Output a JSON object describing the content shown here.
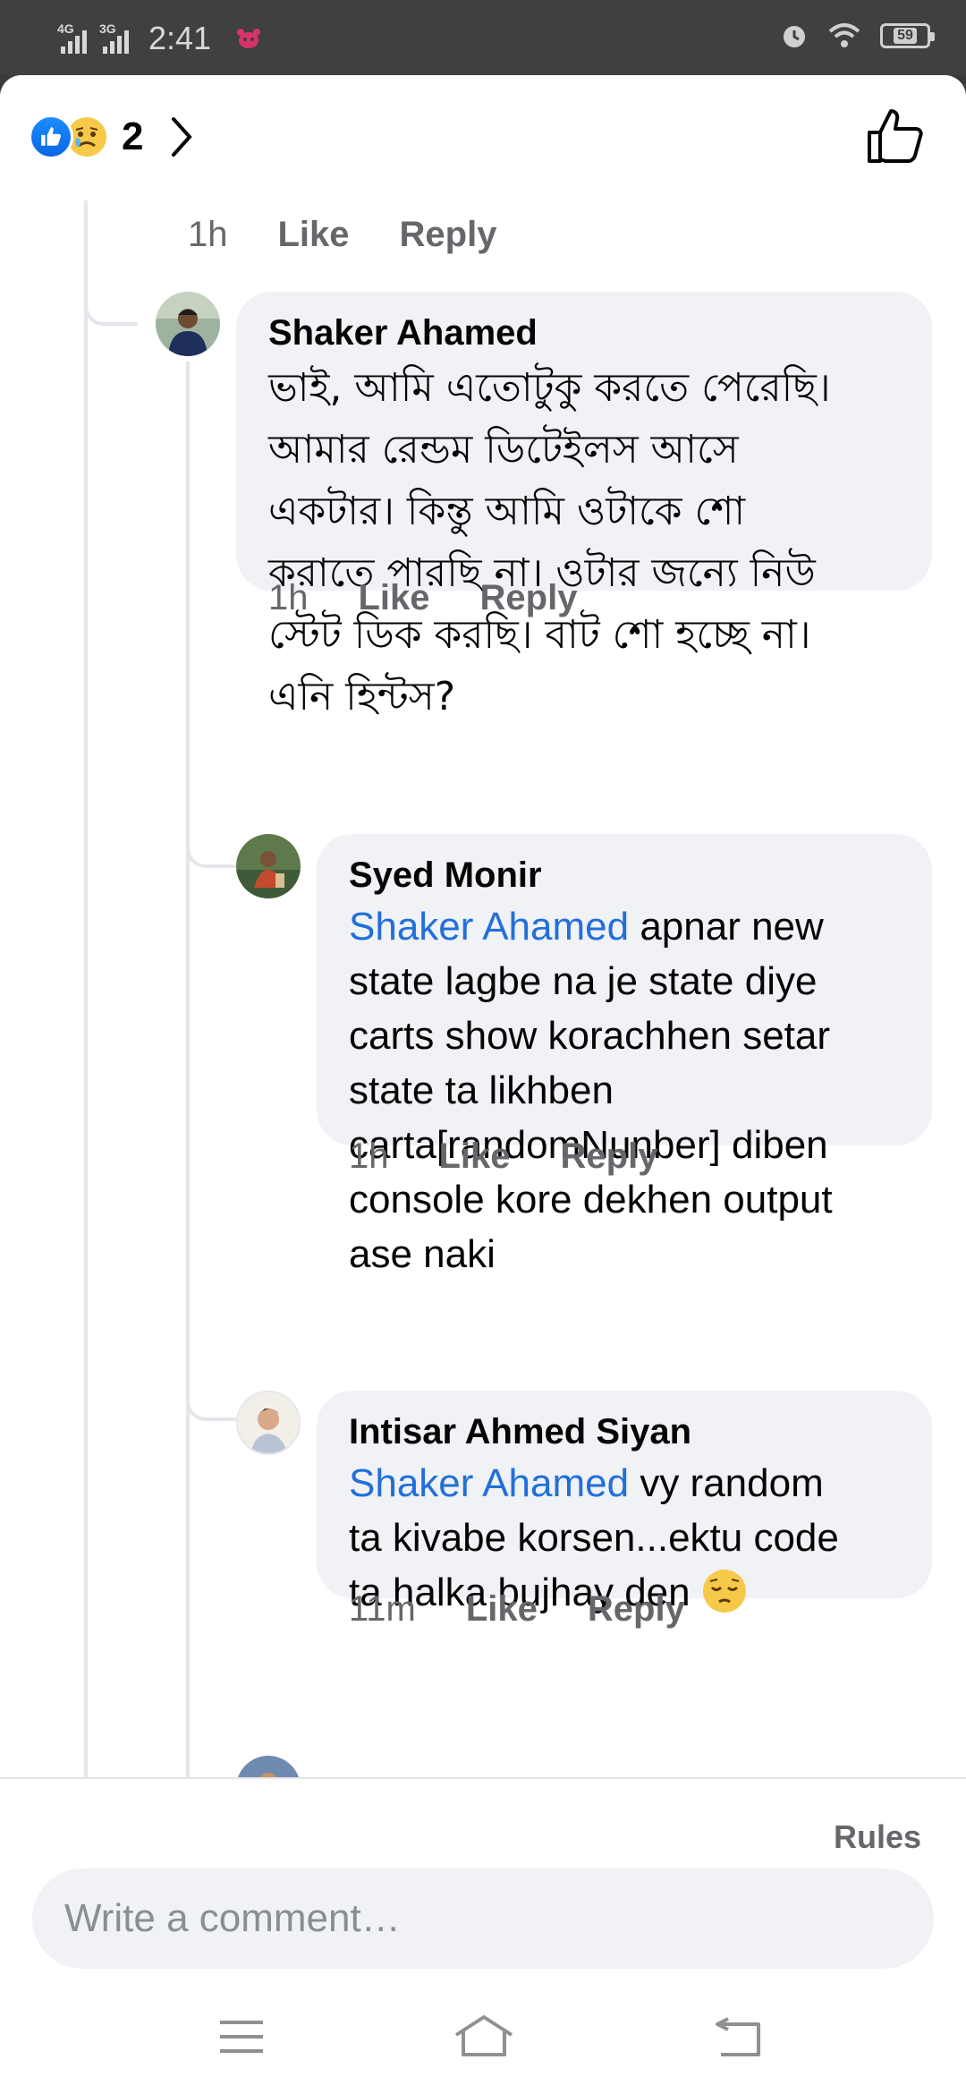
{
  "status": {
    "net1": "4G",
    "net2": "3G",
    "time": "2:41",
    "battery": "59"
  },
  "header": {
    "reaction_count": "2",
    "reactions": [
      "like",
      "sad"
    ]
  },
  "thread": {
    "top_meta": {
      "time": "1h",
      "like": "Like",
      "reply": "Reply"
    },
    "comments": [
      {
        "author": "Shaker Ahamed",
        "lines": [
          "ভাই, আমি এতোটুকু করতে পেরেছি।",
          "আমার রেন্ডম ডিটেইলস আসে",
          "একটার। কিন্তু আমি ওটাকে শো",
          "করাতে পারছি না। ওটার জন্যে নিউ",
          "স্টেট ডিক করছি। বাট শো হচ্ছে না।",
          "এনি হিন্টস?"
        ],
        "time": "1h",
        "like": "Like",
        "reply": "Reply"
      },
      {
        "author": "Syed Monir",
        "mention": "Shaker Ahamed",
        "first_line_rest": " apnar new",
        "lines": [
          "state lagbe na je state diye",
          "carts show korachhen setar",
          "state ta likhben",
          "carta[randomNunber] diben",
          "console kore dekhen output",
          "ase naki"
        ],
        "time": "1h",
        "like": "Like",
        "reply": "Reply"
      },
      {
        "author": "Intisar Ahmed Siyan",
        "mention": "Shaker Ahamed",
        "first_line_rest": " vy random",
        "lines": [
          "ta kivabe korsen...ektu code",
          "ta halka bujhay den"
        ],
        "emoji": "pensive-face",
        "time": "11m",
        "like": "Like",
        "reply": "Reply"
      }
    ]
  },
  "footer": {
    "rules": "Rules",
    "placeholder": "Write a comment…"
  },
  "colors": {
    "mention": "#216fdb",
    "bubble": "#f0f2f5",
    "meta": "#65676b"
  }
}
